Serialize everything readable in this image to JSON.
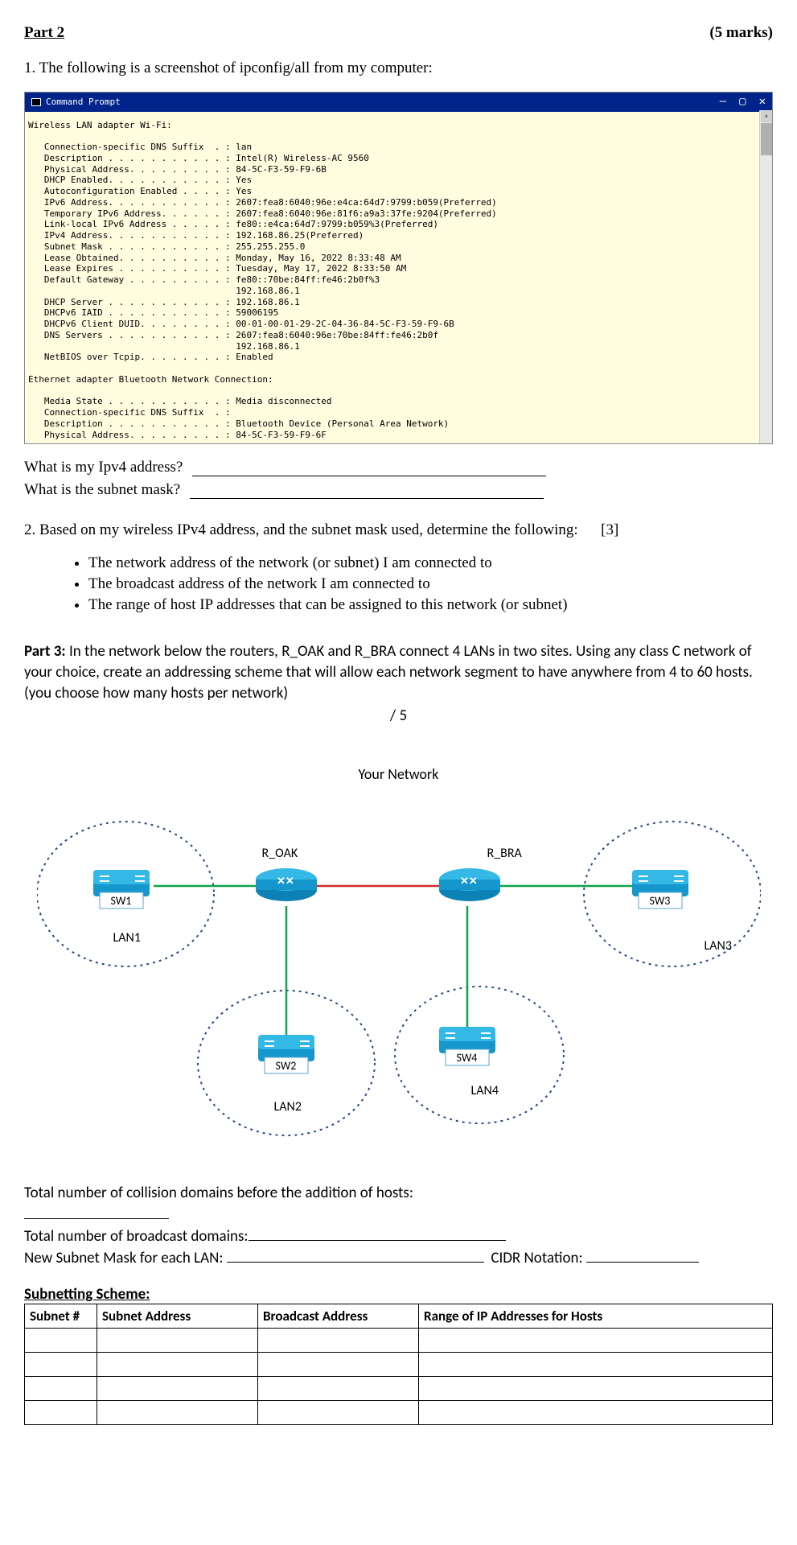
{
  "header": {
    "part": "Part 2",
    "marks": "(5 marks)"
  },
  "q1_intro": "1.  The following is a screenshot of ipconfig/all from my computer:",
  "term": {
    "title": "Command Prompt",
    "min": "—",
    "max": "▢",
    "close": "✕",
    "body": "Wireless LAN adapter Wi-Fi:\n\n   Connection-specific DNS Suffix  . : lan\n   Description . . . . . . . . . . . : Intel(R) Wireless-AC 9560\n   Physical Address. . . . . . . . . : 84-5C-F3-59-F9-6B\n   DHCP Enabled. . . . . . . . . . . : Yes\n   Autoconfiguration Enabled . . . . : Yes\n   IPv6 Address. . . . . . . . . . . : 2607:fea8:6040:96e:e4ca:64d7:9799:b059(Preferred)\n   Temporary IPv6 Address. . . . . . : 2607:fea8:6040:96e:81f6:a9a3:37fe:9204(Preferred)\n   Link-local IPv6 Address . . . . . : fe80::e4ca:64d7:9799:b059%3(Preferred)\n   IPv4 Address. . . . . . . . . . . : 192.168.86.25(Preferred)\n   Subnet Mask . . . . . . . . . . . : 255.255.255.0\n   Lease Obtained. . . . . . . . . . : Monday, May 16, 2022 8:33:48 AM\n   Lease Expires . . . . . . . . . . : Tuesday, May 17, 2022 8:33:50 AM\n   Default Gateway . . . . . . . . . : fe80::70be:84ff:fe46:2b0f%3\n                                       192.168.86.1\n   DHCP Server . . . . . . . . . . . : 192.168.86.1\n   DHCPv6 IAID . . . . . . . . . . . : 59006195\n   DHCPv6 Client DUID. . . . . . . . : 00-01-00-01-29-2C-04-36-84-5C-F3-59-F9-6B\n   DNS Servers . . . . . . . . . . . : 2607:fea8:6040:96e:70be:84ff:fe46:2b0f\n                                       192.168.86.1\n   NetBIOS over Tcpip. . . . . . . . : Enabled\n\nEthernet adapter Bluetooth Network Connection:\n\n   Media State . . . . . . . . . . . : Media disconnected\n   Connection-specific DNS Suffix  . :\n   Description . . . . . . . . . . . : Bluetooth Device (Personal Area Network)\n   Physical Address. . . . . . . . . : 84-5C-F3-59-F9-6F"
  },
  "q1": {
    "a": "What is my Ipv4 address?",
    "b": "What is the subnet mask?"
  },
  "q2": {
    "intro": "2.   Based on my wireless IPv4 address, and the subnet mask used, determine the following:",
    "pts": "[3]",
    "b1": "The network address of the network (or subnet) I am connected to",
    "b2": "The broadcast address of the network I am connected to",
    "b3": "The range of host IP addresses that can be assigned to this network (or subnet)"
  },
  "part3": {
    "label": "Part 3:",
    "text1": " In the network below the routers, R_OAK and R_BRA connect 4 LANs in two sites. Using any class C network of your choice, create an addressing scheme that will allow each network segment to have anywhere from 4 to 60 hosts.",
    "text2": "(you choose how many hosts per network)",
    "score": "/ 5"
  },
  "diagram": {
    "title": "Your Network",
    "r_oak": "R_OAK",
    "r_bra": "R_BRA",
    "sw1": "SW1",
    "sw2": "SW2",
    "sw3": "SW3",
    "sw4": "SW4",
    "lan1": "LAN1",
    "lan2": "LAN2",
    "lan3": "LAN3",
    "lan4": "LAN4"
  },
  "p3q": {
    "coll": "Total number of collision domains before the addition of hosts:",
    "bcast": "Total number of broadcast domains:",
    "mask": "New Subnet Mask for each LAN:",
    "cidr": "CIDR Notation:"
  },
  "scheme": {
    "title": "Subnetting Scheme:",
    "h1": "Subnet #",
    "h2": "Subnet Address",
    "h3": "Broadcast Address",
    "h4": "Range of IP Addresses for Hosts"
  }
}
